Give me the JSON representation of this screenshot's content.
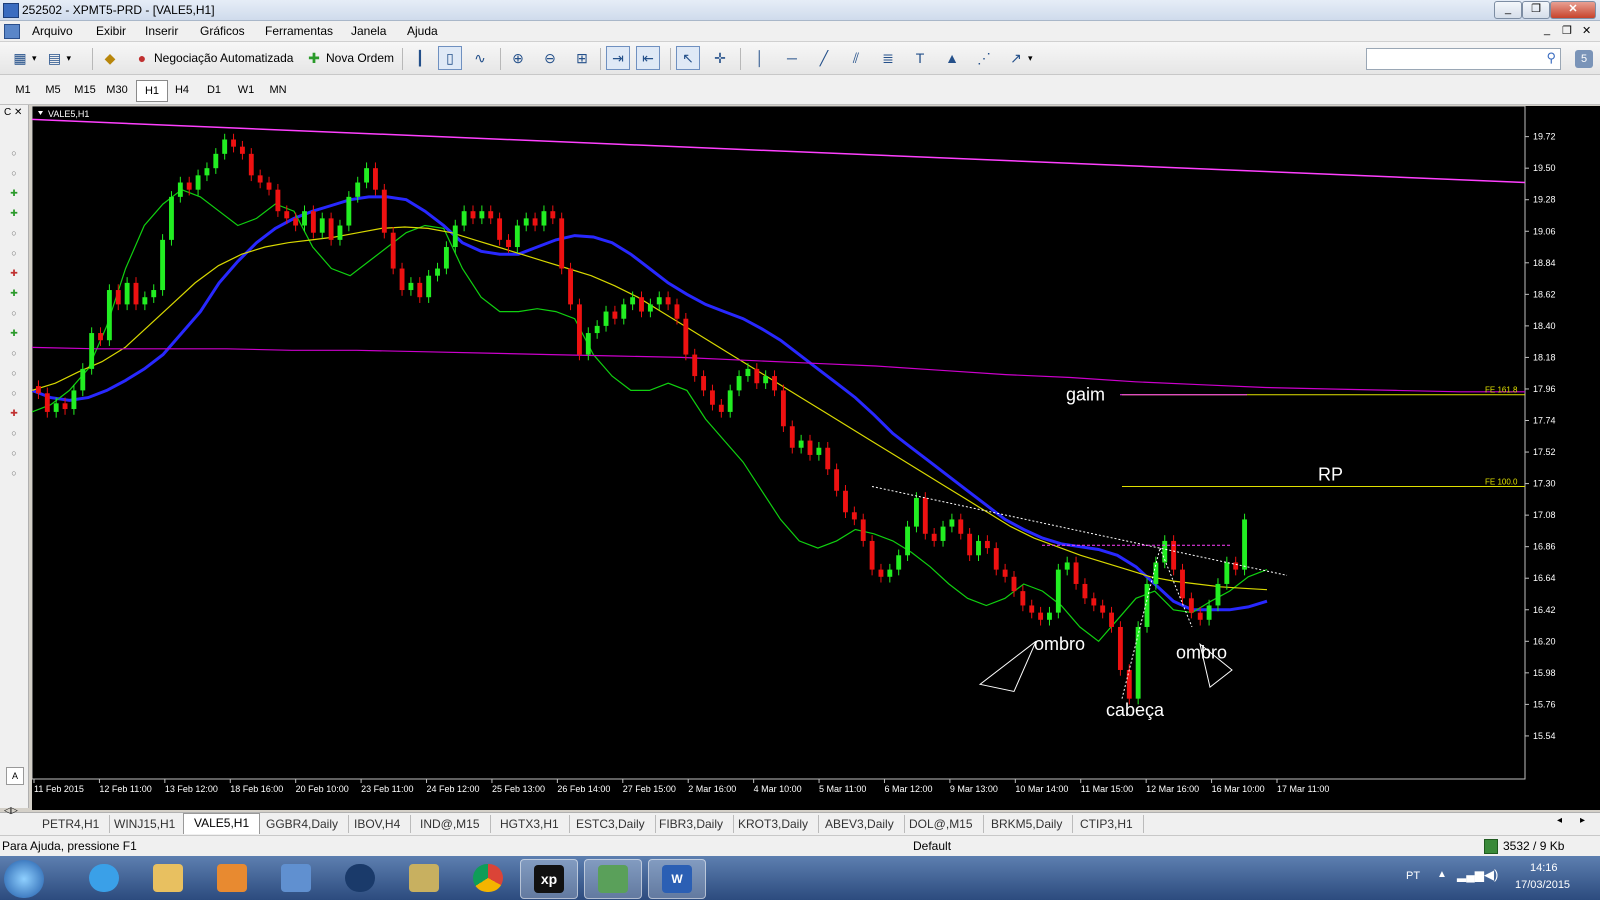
{
  "window": {
    "title": "252502 - XPMT5-PRD - [VALE5,H1]"
  },
  "menu": [
    "Arquivo",
    "Exibir",
    "Inserir",
    "Gráficos",
    "Ferramentas",
    "Janela",
    "Ajuda"
  ],
  "toolbar": {
    "auto_trading": "Negociação Automatizada",
    "new_order": "Nova Ordem"
  },
  "timeframes": [
    "M1",
    "M5",
    "M15",
    "M30",
    "H1",
    "H4",
    "D1",
    "W1",
    "MN"
  ],
  "active_timeframe": "H1",
  "chart_data": {
    "type": "candlestick",
    "symbol_label": "VALE5,H1",
    "y_ticks": [
      "19.72",
      "19.50",
      "19.28",
      "19.06",
      "18.84",
      "18.62",
      "18.40",
      "18.18",
      "17.96",
      "17.74",
      "17.52",
      "17.30",
      "17.08",
      "16.86",
      "16.64",
      "16.42",
      "16.20",
      "15.98",
      "15.76",
      "15.54"
    ],
    "ylim": [
      15.4,
      19.85
    ],
    "x_ticks": [
      "11 Feb 2015",
      "12 Feb 11:00",
      "13 Feb 12:00",
      "18 Feb 16:00",
      "20 Feb 10:00",
      "23 Feb 11:00",
      "24 Feb 12:00",
      "25 Feb 13:00",
      "26 Feb 14:00",
      "27 Feb 15:00",
      "2 Mar 16:00",
      "4 Mar 10:00",
      "5 Mar 11:00",
      "6 Mar 12:00",
      "9 Mar 13:00",
      "10 Mar 14:00",
      "11 Mar 15:00",
      "12 Mar 16:00",
      "16 Mar 10:00",
      "17 Mar 11:00"
    ],
    "close": [
      17.93,
      17.8,
      17.86,
      17.82,
      17.95,
      18.1,
      18.35,
      18.3,
      18.65,
      18.55,
      18.7,
      18.55,
      18.6,
      18.65,
      19.0,
      19.3,
      19.4,
      19.35,
      19.45,
      19.5,
      19.6,
      19.7,
      19.65,
      19.6,
      19.45,
      19.4,
      19.35,
      19.2,
      19.15,
      19.1,
      19.2,
      19.05,
      19.15,
      19.0,
      19.1,
      19.3,
      19.4,
      19.5,
      19.35,
      19.05,
      18.8,
      18.65,
      18.7,
      18.6,
      18.75,
      18.8,
      18.95,
      19.1,
      19.2,
      19.15,
      19.2,
      19.15,
      19.0,
      18.95,
      19.1,
      19.15,
      19.1,
      19.2,
      19.15,
      18.8,
      18.55,
      18.2,
      18.35,
      18.4,
      18.5,
      18.45,
      18.55,
      18.6,
      18.5,
      18.55,
      18.6,
      18.55,
      18.45,
      18.2,
      18.05,
      17.95,
      17.85,
      17.8,
      17.95,
      18.05,
      18.1,
      18.0,
      18.05,
      17.95,
      17.7,
      17.55,
      17.6,
      17.5,
      17.55,
      17.4,
      17.25,
      17.1,
      17.05,
      16.9,
      16.7,
      16.65,
      16.7,
      16.8,
      17.0,
      17.2,
      16.95,
      16.9,
      17.0,
      17.05,
      16.95,
      16.8,
      16.9,
      16.85,
      16.7,
      16.65,
      16.55,
      16.45,
      16.4,
      16.35,
      16.4,
      16.7,
      16.75,
      16.6,
      16.5,
      16.45,
      16.4,
      16.3,
      16.0,
      15.8,
      16.3,
      16.6,
      16.75,
      16.9,
      16.7,
      16.5,
      16.4,
      16.35,
      16.45,
      16.6,
      16.75,
      16.7,
      17.05
    ],
    "series": [
      {
        "color": "#2828ff",
        "values": [
          17.95,
          17.9,
          17.88,
          17.9,
          17.95,
          18.02,
          18.1,
          18.2,
          18.35,
          18.5,
          18.7,
          18.85,
          18.98,
          19.08,
          19.15,
          19.2,
          19.24,
          19.28,
          19.3,
          19.3,
          19.28,
          19.2,
          19.1,
          18.98,
          18.92,
          18.9,
          18.9,
          18.95,
          19.0,
          19.03,
          19.02,
          18.98,
          18.9,
          18.8,
          18.7,
          18.62,
          18.55,
          18.5,
          18.45,
          18.38,
          18.3,
          18.2,
          18.1,
          18.0,
          17.9,
          17.78,
          17.65,
          17.55,
          17.45,
          17.35,
          17.25,
          17.15,
          17.05,
          16.98,
          16.92,
          16.88,
          16.86,
          16.84,
          16.8,
          16.72,
          16.6,
          16.48,
          16.42,
          16.42,
          16.42,
          16.44,
          16.48
        ]
      },
      {
        "color": "#10d010",
        "values": [
          17.8,
          17.85,
          17.95,
          18.1,
          18.4,
          18.8,
          19.1,
          19.25,
          19.35,
          19.3,
          19.2,
          19.1,
          19.15,
          19.25,
          19.2,
          18.95,
          18.8,
          18.75,
          18.85,
          18.95,
          19.05,
          19.1,
          19.08,
          18.8,
          18.6,
          18.5,
          18.5,
          18.52,
          18.5,
          18.45,
          18.2,
          18.05,
          17.95,
          17.95,
          18.0,
          17.95,
          17.75,
          17.6,
          17.45,
          17.25,
          17.05,
          16.9,
          16.85,
          16.9,
          16.98,
          16.95,
          16.9,
          16.82,
          16.72,
          16.6,
          16.5,
          16.45,
          16.5,
          16.6,
          16.55,
          16.45,
          16.3,
          16.2,
          16.35,
          16.5,
          16.55,
          16.42,
          16.4,
          16.48,
          16.55,
          16.65,
          16.7
        ]
      },
      {
        "color": "#d8d800",
        "values": [
          17.95,
          18.0,
          18.08,
          18.15,
          18.25,
          18.4,
          18.55,
          18.7,
          18.82,
          18.9,
          18.95,
          18.98,
          19.0,
          19.02,
          19.05,
          19.08,
          19.09,
          19.08,
          19.05,
          19.0,
          18.95,
          18.9,
          18.85,
          18.8,
          18.75,
          18.68,
          18.6,
          18.5,
          18.4,
          18.3,
          18.2,
          18.1,
          18.0,
          17.9,
          17.8,
          17.7,
          17.6,
          17.5,
          17.4,
          17.3,
          17.2,
          17.1,
          17.0,
          16.92,
          16.86,
          16.8,
          16.75,
          16.7,
          16.65,
          16.62,
          16.6,
          16.58,
          16.57,
          16.56
        ]
      },
      {
        "color": "#cc00cc",
        "values": [
          18.25,
          18.24,
          18.24,
          18.24,
          18.23,
          18.23,
          18.22,
          18.21,
          18.2,
          18.19,
          18.18,
          18.16,
          18.14,
          18.12,
          18.09,
          18.06,
          18.04,
          18.01,
          17.99,
          17.97,
          17.96,
          17.95,
          17.94,
          17.94
        ]
      }
    ],
    "fe_levels": [
      {
        "label": "FE 161.8",
        "value": 17.92
      },
      {
        "label": "FE 100.0",
        "value": 17.28
      }
    ],
    "annotations": [
      "gaim",
      "RP",
      "ombro",
      "cabeça",
      "ombro"
    ]
  },
  "chart_tabs": [
    "PETR4,H1",
    "WINJ15,H1",
    "VALE5,H1",
    "GGBR4,Daily",
    "IBOV,H4",
    "IND@,M15",
    "HGTX3,H1",
    "ESTC3,Daily",
    "FIBR3,Daily",
    "KROT3,Daily",
    "ABEV3,Daily",
    "DOL@,M15",
    "BRKM5,Daily",
    "CTIP3,H1"
  ],
  "active_tab": "VALE5,H1",
  "status": {
    "help": "Para Ajuda, pressione F1",
    "profile": "Default",
    "traffic": "3532 / 9 Kb"
  },
  "taskbar": {
    "lang": "PT",
    "time": "14:16",
    "date": "17/03/2015"
  },
  "colors": {
    "bull": "#22ee22",
    "bear": "#ee1111",
    "background": "#000000"
  }
}
